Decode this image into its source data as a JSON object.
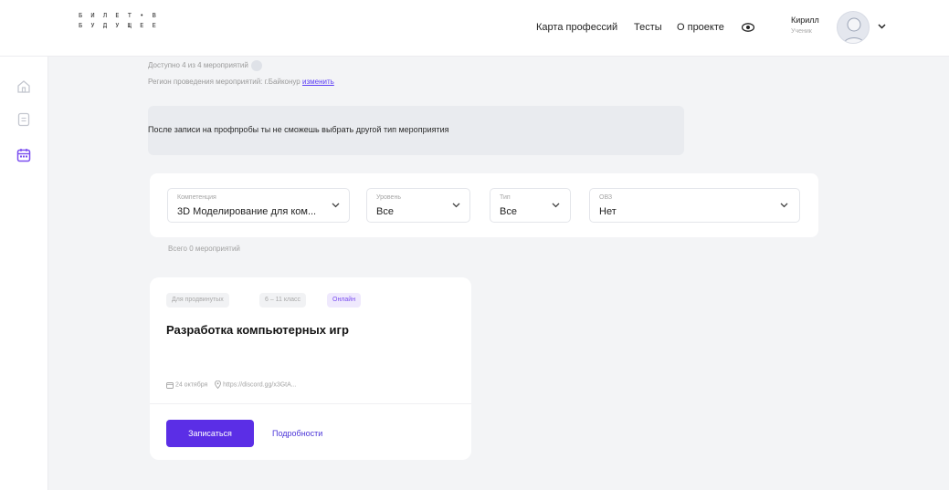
{
  "header": {
    "logo_line1": "Б И Л Е Т • В",
    "logo_line2": "Б У Д У Щ Е Е",
    "nav": [
      "Карта профессий",
      "Тесты",
      "О проекте"
    ],
    "user_name": "Кирилл",
    "user_role": "Ученик"
  },
  "sidebar": {
    "icons": [
      "home-icon",
      "document-icon",
      "calendar-icon"
    ],
    "active_color": "#7b4ff0"
  },
  "info": {
    "available": "Доступно 4 из 4 мероприятий",
    "region_prefix": "Регион проведения мероприятий: г.Байконур",
    "region_link": "изменить"
  },
  "notice": {
    "text": "После записи на профпробы ты не сможешь выбрать другой тип мероприятия"
  },
  "filters": [
    {
      "label": "Компетенция",
      "value": "3D Моделирование для ком..."
    },
    {
      "label": "Уровень",
      "value": "Все"
    },
    {
      "label": "Тип",
      "value": "Все"
    },
    {
      "label": "ОВЗ",
      "value": "Нет"
    }
  ],
  "total": "Всего 0 мероприятий",
  "card": {
    "tags": [
      "Для продвинутых",
      "6 – 11 класс",
      "Онлайн"
    ],
    "title": "Разработка компьютерных игр",
    "date": "24 октября",
    "location": "https://discord.gg/x3GtA...",
    "signup_label": "Записаться",
    "details_label": "Подробности"
  },
  "colors": {
    "accent": "#5b2ee6",
    "tag_purple_bg": "#efe9fd",
    "page_bg": "#f3f4f6"
  }
}
